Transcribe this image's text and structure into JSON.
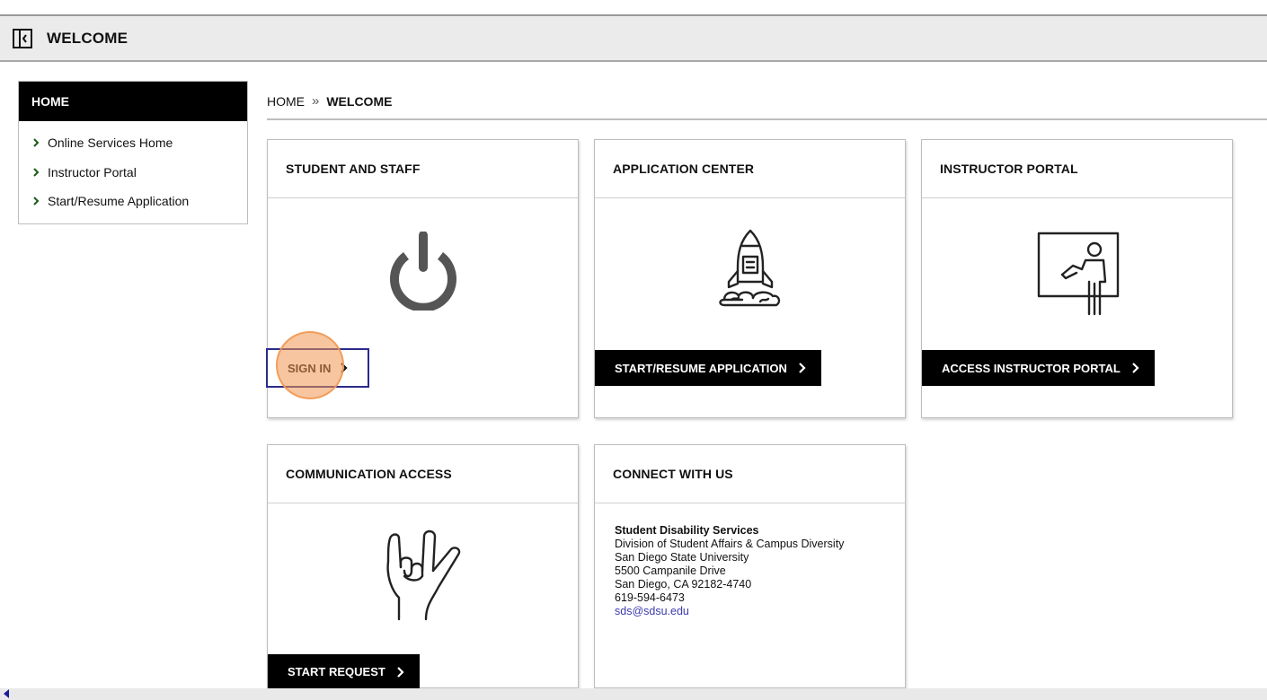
{
  "header": {
    "title": "WELCOME",
    "toggle_icon": "sidebar-toggle-icon"
  },
  "sidebar": {
    "heading": "HOME",
    "items": [
      {
        "label": "Online Services Home"
      },
      {
        "label": "Instructor Portal"
      },
      {
        "label": "Start/Resume Application"
      }
    ]
  },
  "breadcrumb": {
    "home": "HOME",
    "separator": "»",
    "current": "WELCOME"
  },
  "cards": {
    "student_staff": {
      "title": "STUDENT AND STAFF",
      "icon": "power-icon",
      "button": "SIGN IN"
    },
    "application_center": {
      "title": "APPLICATION CENTER",
      "icon": "rocket-icon",
      "button": "START/RESUME APPLICATION"
    },
    "instructor_portal": {
      "title": "INSTRUCTOR PORTAL",
      "icon": "instructor-presentation-icon",
      "button": "ACCESS INSTRUCTOR PORTAL"
    },
    "communication_access": {
      "title": "COMMUNICATION ACCESS",
      "icon": "sign-language-hand-icon",
      "button": "START REQUEST"
    },
    "connect": {
      "title": "CONNECT WITH US",
      "org": "Student Disability Services",
      "division": "Division of Student Affairs & Campus Diversity",
      "university": "San Diego State University",
      "street": "5500 Campanile Drive",
      "city": "San Diego, CA 92182-4740",
      "phone": "619-594-6473",
      "email": "sds@sdsu.edu"
    }
  },
  "colors": {
    "accent_button": "#000000",
    "link": "#3b3bb0",
    "focus_border": "#2a2a8a",
    "click_highlight": "#f0a060"
  }
}
